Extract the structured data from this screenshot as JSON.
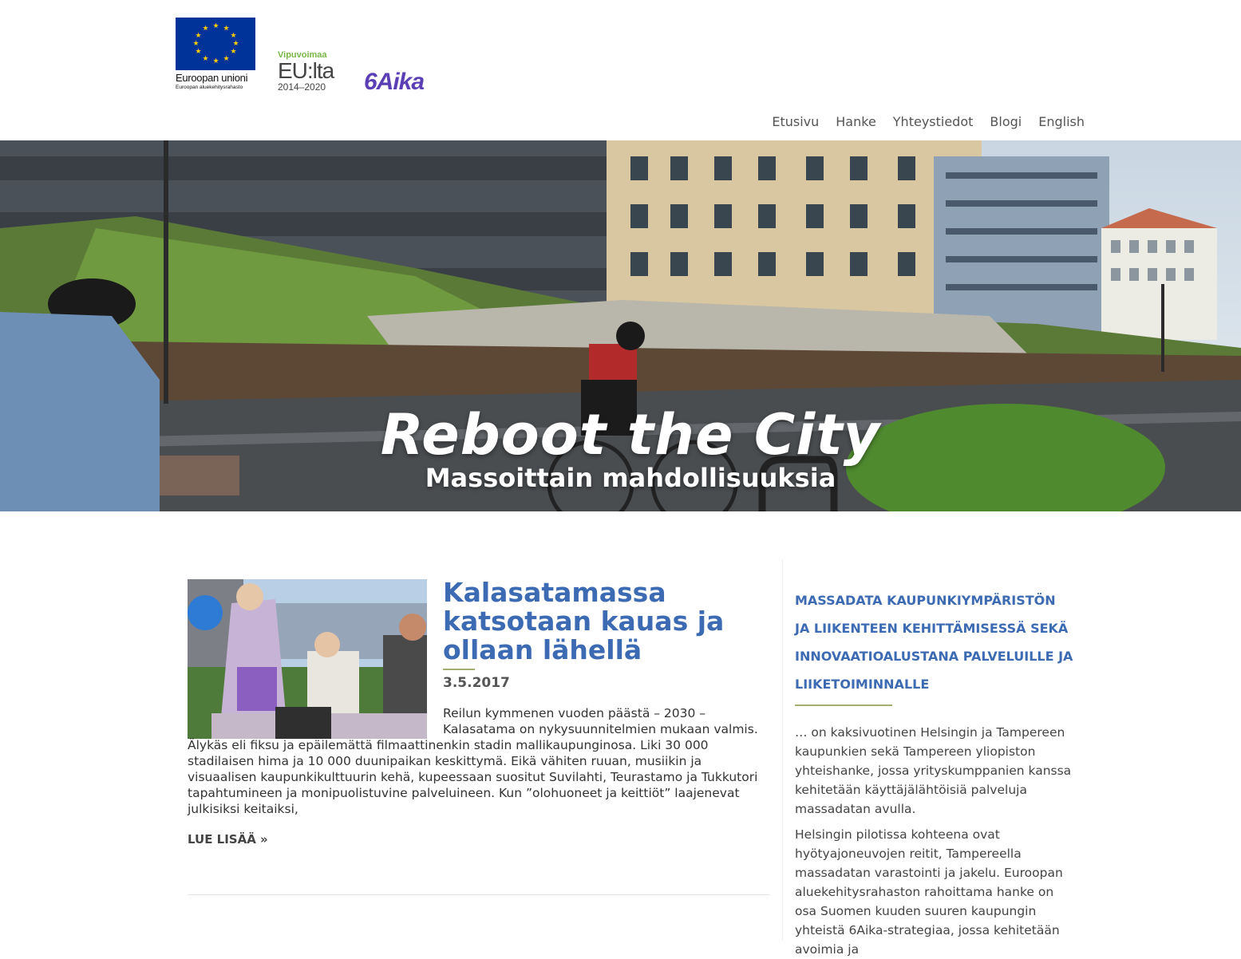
{
  "header": {
    "eu_logo": {
      "name": "Euroopan unioni",
      "subtitle": "Euroopan aluekehitysrahasto"
    },
    "vipuvoimaa_logo": {
      "top": "Vipuvoimaa",
      "middle": "EU:lta",
      "years": "2014–2020"
    },
    "aika_logo": {
      "text": "6Aika"
    }
  },
  "nav": {
    "items": [
      {
        "label": "Etusivu"
      },
      {
        "label": "Hanke"
      },
      {
        "label": "Yhteystiedot"
      },
      {
        "label": "Blogi"
      },
      {
        "label": "English"
      }
    ]
  },
  "hero": {
    "title": "Reboot the City",
    "subtitle": "Massoittain mahdollisuuksia"
  },
  "post": {
    "title": "Kalasatamassa katsotaan kauas ja ollaan lähellä",
    "date": "3.5.2017",
    "excerpt": "Reilun kymmenen vuoden päästä – 2030 – Kalasatama on nykysuunnitelmien mukaan valmis. Älykäs eli fiksu ja epäilemättä filmaattinenkin stadin mallikaupunginosa. Liki 30 000 stadilaisen hima ja 10 000 duunipaikan keskittymä. Eikä vähiten ruuan, musiikin ja visuaalisen kaupunkikulttuurin kehä, kupeessaan suositut Suvilahti, Teurastamo ja Tukkutori tapahtumineen ja monipuolistuvine palveluineen. Kun ”olohuoneet ja keittiöt” laajenevat julkisiksi keitaiksi,",
    "read_more": "LUE LISÄÄ »"
  },
  "sidebar": {
    "heading": "MASSADATA KAUPUNKIYMPÄRISTÖN JA LIIKENTEEN KEHITTÄMISESSÄ SEKÄ INNOVAATIOALUSTANA PALVELUILLE JA LIIKETOIMINNALLE",
    "paragraph1": "… on kaksivuotinen Helsingin ja Tampereen kaupunkien sekä Tampereen yliopiston yhteishanke, jossa yrityskumppanien kanssa kehitetään käyttäjälähtöisiä palveluja massadatan avulla.",
    "paragraph2": "Helsingin pilotissa kohteena ovat hyötyajoneuvojen reitit, Tampereella massadatan varastointi ja jakelu. Euroopan aluekehitysrahaston rahoittama hanke on osa Suomen kuuden suuren kaupungin yhteistä 6Aika-strategiaa, jossa kehitetään avoimia ja"
  },
  "colors": {
    "accent_blue": "#3d6bb3",
    "rule_green": "#a3b06d",
    "eu_blue": "#003399",
    "eu_yellow": "#ffcc00",
    "vipu_green": "#7ab648",
    "aika_purple": "#5b3fb5"
  }
}
